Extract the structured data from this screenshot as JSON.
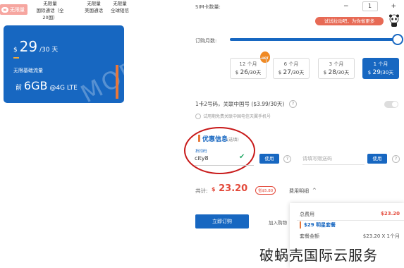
{
  "features": {
    "badge": "无限量",
    "badge_icon": "infinity-icon",
    "items": [
      {
        "line1": "无限量",
        "line2": "国际通话（全 20国）"
      },
      {
        "line1": "无限量",
        "line2": "美国通话"
      },
      {
        "line1": "无限量",
        "line2": "全球短信"
      }
    ]
  },
  "plan_card": {
    "currency": "$",
    "price": "29",
    "period": "/30 天",
    "data_label": "无限基础流量",
    "data_prefix": "前",
    "data_amount": "6GB",
    "data_suffix": "@4G LTE",
    "watermark": "MORE"
  },
  "sim": {
    "label": "SIM卡数量:",
    "minus": "−",
    "quantity": "1",
    "plus": "+",
    "promo": "试试拉动吧，为你省更多"
  },
  "months": {
    "label": "订购月数:",
    "slider_level": 1.0,
    "hot_label": "HOT",
    "options": [
      {
        "term": "12 个月",
        "price": "26",
        "per": "/30天",
        "selected": false
      },
      {
        "term": "6 个月",
        "price": "27",
        "per": "/30天",
        "selected": false
      },
      {
        "term": "3 个月",
        "price": "28",
        "per": "/30天",
        "selected": false
      },
      {
        "term": "1 个月",
        "price": "29",
        "per": "/30天",
        "selected": true
      }
    ]
  },
  "addon": {
    "text": "1卡2号码，关联中国号 ($3.99/30天)",
    "help": "?",
    "toggle_on": false,
    "hint": "试用期免费关联中国电信天翼手机号"
  },
  "coupon": {
    "title": "优惠信息",
    "optional": "(选填)",
    "code_label": "折扣码",
    "code_value": "city8",
    "apply": "使用",
    "help": "?",
    "gift_placeholder": "请填写赠送码",
    "apply2": "使用",
    "help2": "?"
  },
  "total": {
    "label": "共计:",
    "currency": "$",
    "amount": "23.20",
    "badge": "省$5.80",
    "detail_link": "费用明细",
    "chevron": "^"
  },
  "order": {
    "button": "立即订购",
    "cart": "加入购物"
  },
  "summary": {
    "total_label": "总费用",
    "total_value": "$23.20",
    "plan_name": "$29 明星套餐",
    "line_label": "套餐金额",
    "line_value": "$23.20 X 1个月"
  },
  "watermark_text": "破蜗壳国际云服务",
  "colors": {
    "brand": "#1767c1",
    "accent": "#e8773a",
    "price_red": "#e34a3b",
    "highlight_ring": "#c81a1a"
  }
}
